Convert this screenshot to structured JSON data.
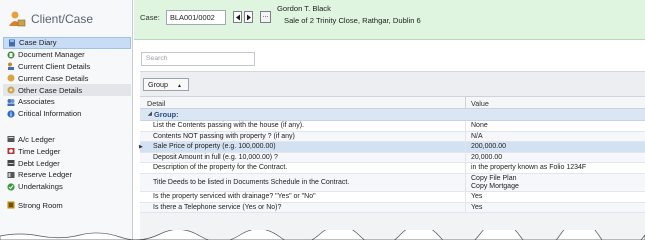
{
  "sidebar": {
    "title": "Client/Case",
    "items": [
      {
        "label": "Case Diary",
        "icon": "case-diary-icon",
        "color": "#3d6fb6"
      },
      {
        "label": "Document Manager",
        "icon": "document-manager-icon",
        "color": "#3a8a3a"
      },
      {
        "label": "Current Client Details",
        "icon": "client-details-icon",
        "color": "#c58a2b"
      },
      {
        "label": "Current Case Details",
        "icon": "case-details-icon",
        "color": "#d9a441"
      },
      {
        "label": "Other Case Details",
        "icon": "other-case-details-icon",
        "color": "#c9a14a"
      },
      {
        "label": "Associates",
        "icon": "associates-icon",
        "color": "#3d6fb6"
      },
      {
        "label": "Critical Information",
        "icon": "info-icon",
        "color": "#2b6cc4"
      },
      {
        "label": "A/c Ledger",
        "icon": "ledger-icon",
        "color": "#555555"
      },
      {
        "label": "Time Ledger",
        "icon": "time-ledger-icon",
        "color": "#b33a3a"
      },
      {
        "label": "Debt Ledger",
        "icon": "debt-ledger-icon",
        "color": "#444444"
      },
      {
        "label": "Reserve Ledger",
        "icon": "reserve-ledger-icon",
        "color": "#555555"
      },
      {
        "label": "Undertakings",
        "icon": "undertakings-icon",
        "color": "#3a9a3a"
      },
      {
        "label": "Strong Room",
        "icon": "strong-room-icon",
        "color": "#b8860b"
      }
    ]
  },
  "header": {
    "case_label": "Case:",
    "case_value": "BLA001/0002",
    "prev_icon": "chevron-left-icon",
    "next_icon": "chevron-right-icon",
    "ellipsis_label": "...",
    "client_name": "Gordon T. Black",
    "case_description": "Sale of 2 Trinity Close, Rathgar, Dublin 6"
  },
  "search": {
    "placeholder": "Search"
  },
  "grid": {
    "group_chip": "Group",
    "columns": [
      "Detail",
      "Value"
    ],
    "group_label": "Group:",
    "rows": [
      {
        "detail": "List the Contents passing with the house (if any).",
        "value": [
          "None"
        ]
      },
      {
        "detail": "Contents NOT passing with property ? (if any)",
        "value": [
          "N/A"
        ]
      },
      {
        "detail": "Sale Price of property (e.g. 100,000.00)",
        "value": [
          "200,000.00"
        ],
        "selected": true
      },
      {
        "detail": "Deposit Amount in full (e.g. 10,000.00) ?",
        "value": [
          "20,000.00"
        ]
      },
      {
        "detail": "Description of the property for the Contract.",
        "value": [
          "in the property known as Folio 1234F"
        ]
      },
      {
        "detail": "Title Deeds to be listed in Documents Schedule in the Contract.",
        "value": [
          "Copy File Plan",
          "Copy Mortgage"
        ],
        "tall": true
      },
      {
        "detail": "Is the property serviced with drainage? \"Yes\" or \"No\"",
        "value": [
          "Yes"
        ]
      },
      {
        "detail": "Is there a Telephone service (Yes or No)?",
        "value": [
          "Yes"
        ]
      }
    ]
  }
}
